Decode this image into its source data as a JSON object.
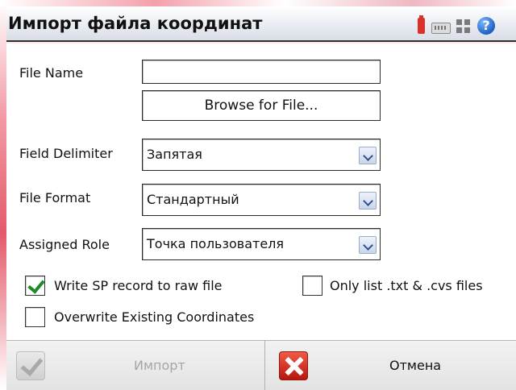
{
  "titlebar": {
    "title": "Импорт файла координат",
    "icons": [
      "battery-icon",
      "keyboard-icon",
      "apps-icon",
      "help-icon"
    ],
    "help_glyph": "?"
  },
  "form": {
    "file_name": {
      "label": "File Name",
      "value": ""
    },
    "browse_button": "Browse for File...",
    "field_delimiter": {
      "label": "Field Delimiter",
      "value": "Запятая"
    },
    "file_format": {
      "label": "File Format",
      "value": "Стандартный"
    },
    "assigned_role": {
      "label": "Assigned Role",
      "value": "Точка пользователя"
    },
    "checkboxes": [
      {
        "label": "Write SP record to raw file",
        "checked": true
      },
      {
        "label": "Only list .txt & .cvs files",
        "checked": false
      },
      {
        "label": "Overwrite Existing Coordinates",
        "checked": false
      }
    ]
  },
  "bottom": {
    "import_label": "Импорт",
    "cancel_label": "Отмена"
  },
  "colors": {
    "check_green": "#1f8a2a",
    "cancel_red": "#c8261b",
    "disabled_text": "#a6a6a6"
  }
}
